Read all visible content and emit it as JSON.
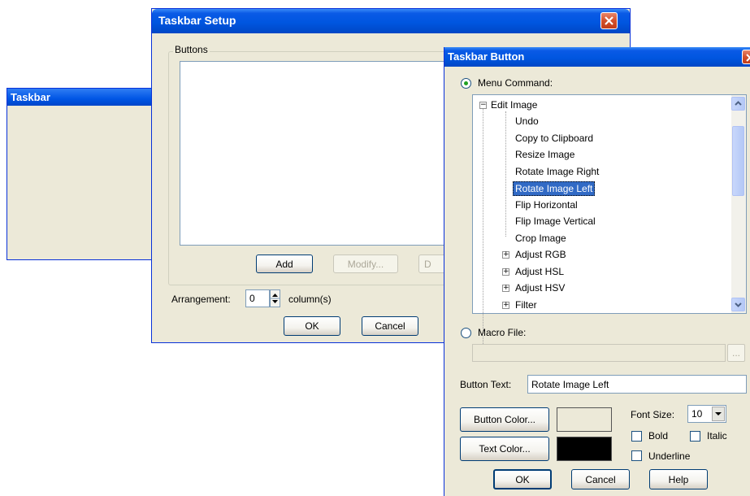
{
  "taskbar_window": {
    "title": "Taskbar"
  },
  "setup_window": {
    "title": "Taskbar Setup",
    "buttons_group_label": "Buttons",
    "add_label": "Add",
    "modify_label": "Modify...",
    "delete_label_partial": "D",
    "arrangement_label": "Arrangement:",
    "arrangement_value": "0",
    "columns_label": "column(s)",
    "ok_label": "OK",
    "cancel_label": "Cancel"
  },
  "button_dialog": {
    "title": "Taskbar Button",
    "menu_command_label": "Menu Command:",
    "menu_command_selected": true,
    "tree": {
      "root": "Edit Image",
      "children": [
        "Undo",
        "Copy to Clipboard",
        "Resize Image",
        "Rotate Image Right",
        "Rotate Image Left",
        "Flip Horizontal",
        "Flip Image Vertical",
        "Crop Image"
      ],
      "selected": "Rotate Image Left",
      "groups": [
        "Adjust RGB",
        "Adjust HSL",
        "Adjust HSV",
        "Filter"
      ]
    },
    "macro_file_label": "Macro File:",
    "macro_file_value": "",
    "browse_label": "...",
    "button_text_label": "Button Text:",
    "button_text_value": "Rotate Image Left",
    "button_color_label": "Button Color...",
    "text_color_label": "Text Color...",
    "button_color": "#ece9d8",
    "text_color": "#000000",
    "font_size_label": "Font Size:",
    "font_size_value": "10",
    "bold_label": "Bold",
    "italic_label": "Italic",
    "underline_label": "Underline",
    "ok_label": "OK",
    "cancel_label": "Cancel",
    "help_label": "Help"
  }
}
